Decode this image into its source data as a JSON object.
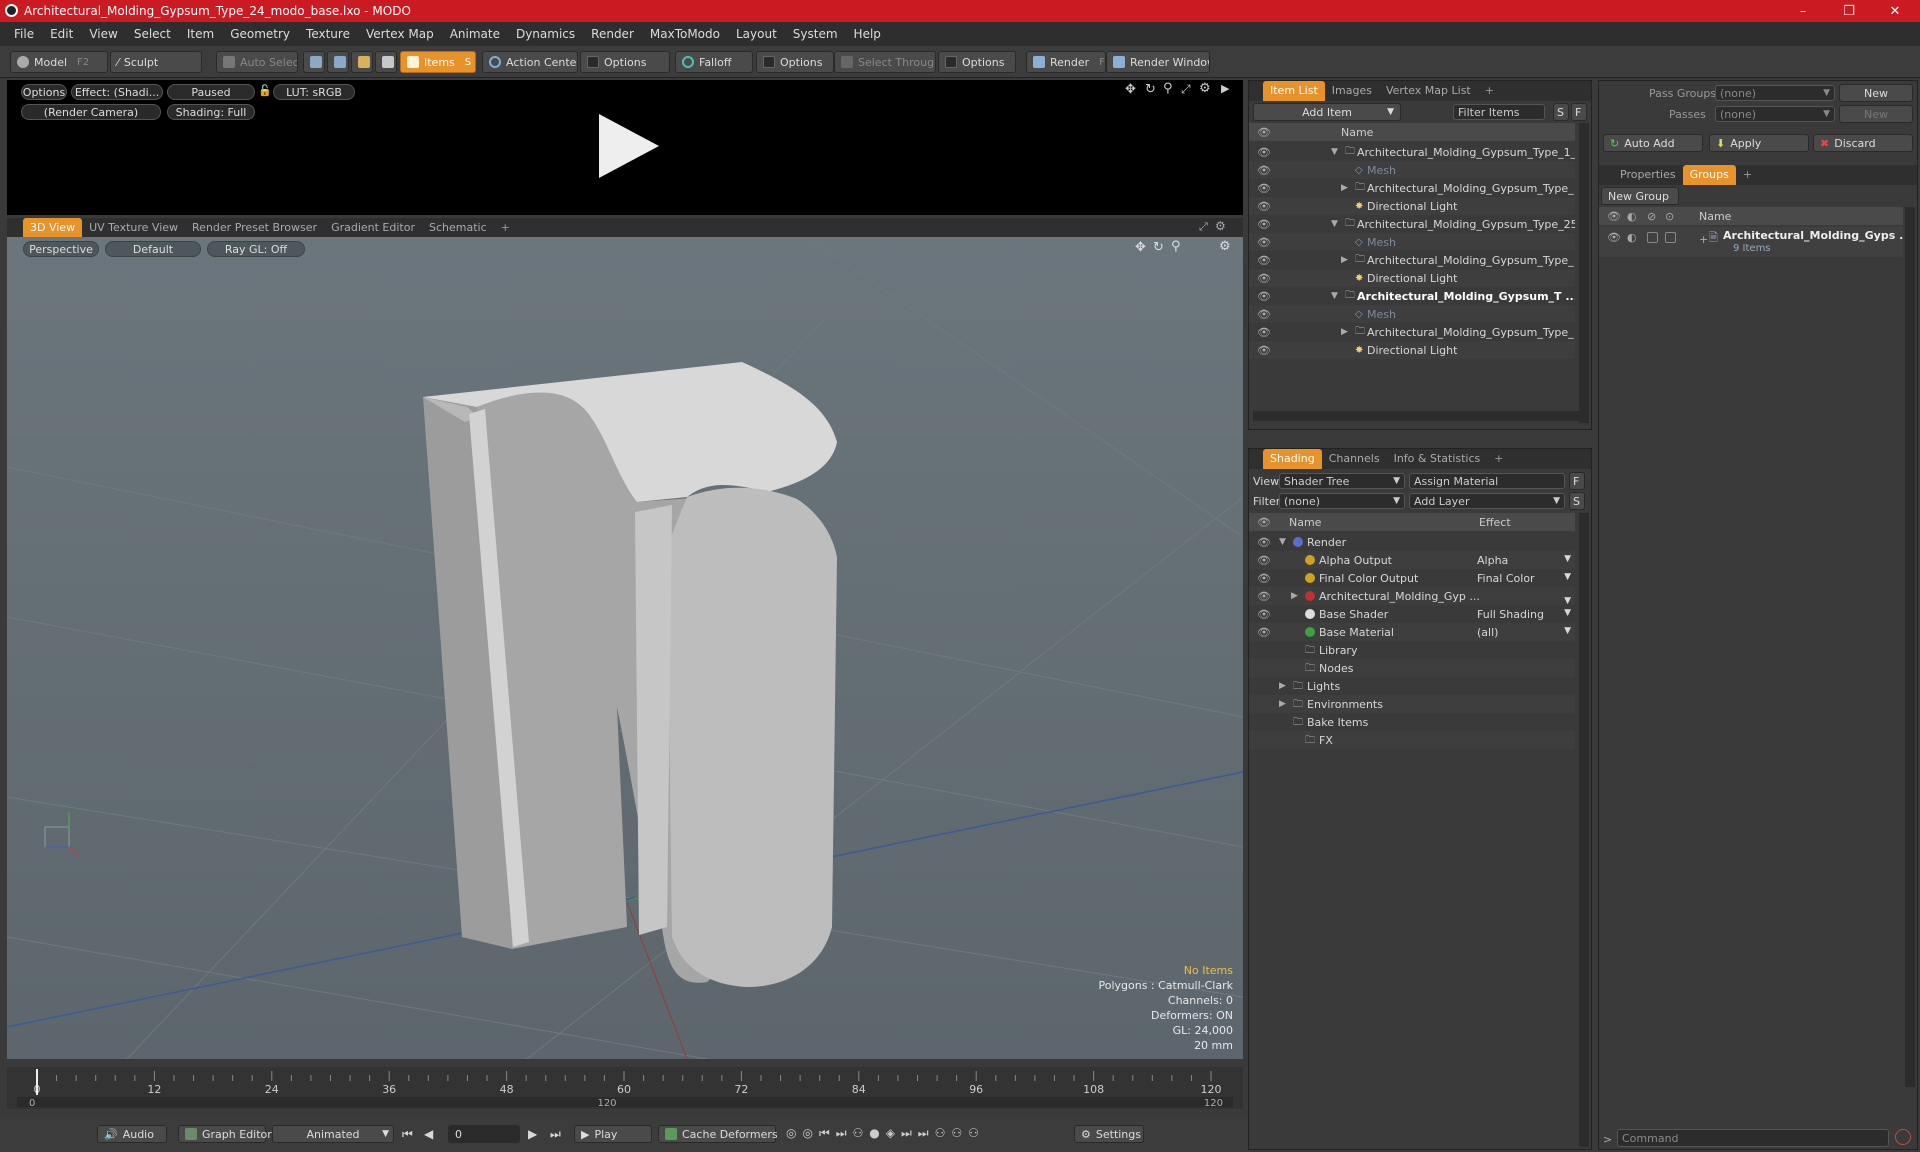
{
  "window": {
    "title": "Architectural_Molding_Gypsum_Type_24_modo_base.lxo - MODO",
    "min": "–",
    "max": "❐",
    "close": "✕"
  },
  "menu": [
    "File",
    "Edit",
    "View",
    "Select",
    "Item",
    "Geometry",
    "Texture",
    "Vertex Map",
    "Animate",
    "Dynamics",
    "Render",
    "MaxToModo",
    "Layout",
    "System",
    "Help"
  ],
  "toolbar": {
    "model": "Model",
    "model_key": "F2",
    "sculpt": "Sculpt",
    "auto_select": "Auto Select",
    "items": "Items",
    "items_key": "S",
    "action_center": "Action Center",
    "options1": "Options",
    "falloff": "Falloff",
    "options2": "Options",
    "select_through": "Select Through",
    "options3": "Options",
    "render": "Render",
    "render_key": "F9",
    "render_window": "Render Window"
  },
  "preview": {
    "options": "Options",
    "effect": "Effect: (Shadi...",
    "paused": "Paused",
    "lut": "LUT: sRGB",
    "camera": "(Render Camera)",
    "shading": "Shading: Full"
  },
  "viewport_tabs": [
    "3D View",
    "UV Texture View",
    "Render Preset Browser",
    "Gradient Editor",
    "Schematic",
    "+"
  ],
  "viewport": {
    "perspective": "Perspective",
    "default": "Default",
    "raygl": "Ray GL: Off",
    "stats": [
      "No Items",
      "Polygons : Catmull-Clark",
      "Channels: 0",
      "Deformers: ON",
      "GL: 24,000",
      "20 mm"
    ]
  },
  "timeline": {
    "ticks": [
      "0",
      "12",
      "24",
      "36",
      "48",
      "60",
      "72",
      "84",
      "96",
      "108",
      "120"
    ],
    "start": "0",
    "mid": "120",
    "end": "120"
  },
  "bottom": {
    "audio": "Audio",
    "graph_editor": "Graph Editor",
    "animated": "Animated",
    "frame": "0",
    "play": "Play",
    "cache": "Cache Deformers",
    "settings": "Settings"
  },
  "item_list": {
    "tabs": [
      "Item List",
      "Images",
      "Vertex Map List",
      "+"
    ],
    "add_item": "Add Item",
    "filter": "Filter Items",
    "s": "S",
    "f": "F",
    "col_name": "Name",
    "rows": [
      {
        "label": "Architectural_Molding_Gypsum_Type_1_ ...",
        "indent": 0,
        "expand": "▼",
        "bold": false,
        "dim": false
      },
      {
        "label": "Mesh",
        "indent": 1,
        "expand": "",
        "bold": false,
        "dim": true
      },
      {
        "label": "Architectural_Molding_Gypsum_Type_ ...",
        "indent": 1,
        "expand": "▶",
        "bold": false,
        "dim": false
      },
      {
        "label": "Directional Light",
        "indent": 1,
        "expand": "",
        "bold": false,
        "dim": false
      },
      {
        "label": "Architectural_Molding_Gypsum_Type_25 ...",
        "indent": 0,
        "expand": "▼",
        "bold": false,
        "dim": false
      },
      {
        "label": "Mesh",
        "indent": 1,
        "expand": "",
        "bold": false,
        "dim": true
      },
      {
        "label": "Architectural_Molding_Gypsum_Type_ ...",
        "indent": 1,
        "expand": "▶",
        "bold": false,
        "dim": false
      },
      {
        "label": "Directional Light",
        "indent": 1,
        "expand": "",
        "bold": false,
        "dim": false
      },
      {
        "label": "Architectural_Molding_Gypsum_T ...",
        "indent": 0,
        "expand": "▼",
        "bold": true,
        "dim": false
      },
      {
        "label": "Mesh",
        "indent": 1,
        "expand": "",
        "bold": false,
        "dim": true
      },
      {
        "label": "Architectural_Molding_Gypsum_Type_ ...",
        "indent": 1,
        "expand": "▶",
        "bold": false,
        "dim": false
      },
      {
        "label": "Directional Light",
        "indent": 1,
        "expand": "",
        "bold": false,
        "dim": false
      }
    ]
  },
  "shading": {
    "tabs": [
      "Shading",
      "Channels",
      "Info & Statistics",
      "+"
    ],
    "view_label": "View",
    "view_value": "Shader Tree",
    "assign": "Assign Material",
    "f": "F",
    "filter_label": "Filter",
    "filter_value": "(none)",
    "add_layer": "Add Layer",
    "s": "S",
    "col_name": "Name",
    "col_effect": "Effect",
    "rows": [
      {
        "label": "Render",
        "effect": "",
        "indent": 0,
        "expand": "▼",
        "eye": true,
        "color": "#5a70c8"
      },
      {
        "label": "Alpha Output",
        "effect": "Alpha",
        "indent": 1,
        "expand": "",
        "eye": true,
        "color": "#d0a020"
      },
      {
        "label": "Final Color Output",
        "effect": "Final Color",
        "indent": 1,
        "expand": "",
        "eye": true,
        "color": "#d0a020"
      },
      {
        "label": "Architectural_Molding_Gyp ...",
        "effect": "",
        "indent": 1,
        "expand": "▶",
        "eye": true,
        "color": "#c03030"
      },
      {
        "label": "Base Shader",
        "effect": "Full Shading",
        "indent": 1,
        "expand": "",
        "eye": true,
        "color": "#dddddd"
      },
      {
        "label": "Base Material",
        "effect": "(all)",
        "indent": 1,
        "expand": "",
        "eye": true,
        "color": "#40a040"
      },
      {
        "label": "Library",
        "effect": "",
        "indent": 1,
        "expand": "",
        "eye": false,
        "color": ""
      },
      {
        "label": "Nodes",
        "effect": "",
        "indent": 1,
        "expand": "",
        "eye": false,
        "color": ""
      },
      {
        "label": "Lights",
        "effect": "",
        "indent": 0,
        "expand": "▶",
        "eye": false,
        "color": ""
      },
      {
        "label": "Environments",
        "effect": "",
        "indent": 0,
        "expand": "▶",
        "eye": false,
        "color": ""
      },
      {
        "label": "Bake Items",
        "effect": "",
        "indent": 0,
        "expand": "",
        "eye": false,
        "color": ""
      },
      {
        "label": "FX",
        "effect": "",
        "indent": 1,
        "expand": "",
        "eye": false,
        "color": ""
      }
    ]
  },
  "groups": {
    "pass_groups": "Pass Groups",
    "pass_groups_value": "(none)",
    "new": "New",
    "passes": "Passes",
    "passes_value": "(none)",
    "new2": "New",
    "auto_add": "Auto Add",
    "apply": "Apply",
    "discard": "Discard",
    "tabs": [
      "Properties",
      "Groups",
      "+"
    ],
    "new_group": "New Group",
    "col_name": "Name",
    "item_name": "Architectural_Molding_Gyps ...",
    "item_count": "9 Items",
    "command": "Command"
  },
  "colors": {
    "accent": "#e8922a",
    "title_red": "#cc1a22"
  }
}
